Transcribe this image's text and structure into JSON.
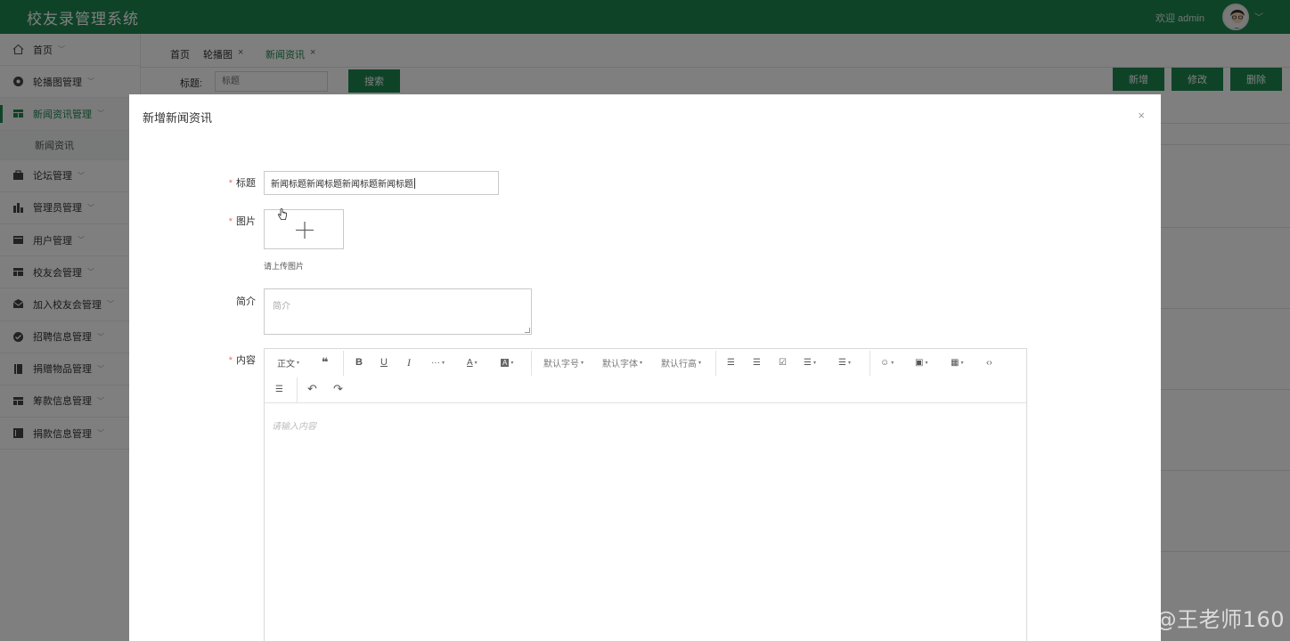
{
  "header": {
    "app_title": "校友录管理系统",
    "welcome": "欢迎 admin",
    "avatar_icon": "user-avatar-icon",
    "chevron": "﹀"
  },
  "sidebar": {
    "items": [
      {
        "label": "首页",
        "icon": "home-icon"
      },
      {
        "label": "轮播图管理",
        "icon": "carousel-icon"
      },
      {
        "label": "新闻资讯管理",
        "icon": "news-icon",
        "active": true
      },
      {
        "label": "论坛管理",
        "icon": "forum-icon"
      },
      {
        "label": "管理员管理",
        "icon": "admin-icon"
      },
      {
        "label": "用户管理",
        "icon": "user-icon"
      },
      {
        "label": "校友会管理",
        "icon": "alumni-icon"
      },
      {
        "label": "加入校友会管理",
        "icon": "mail-icon"
      },
      {
        "label": "招聘信息管理",
        "icon": "recruit-icon"
      },
      {
        "label": "捐赠物品管理",
        "icon": "donation-icon"
      },
      {
        "label": "筹款信息管理",
        "icon": "fundraise-icon"
      },
      {
        "label": "捐款信息管理",
        "icon": "donate-money-icon"
      }
    ],
    "sub_item": "新闻资讯"
  },
  "tabs": [
    {
      "label": "首页",
      "closable": false
    },
    {
      "label": "轮播图",
      "closable": true
    },
    {
      "label": "新闻资讯",
      "closable": true,
      "active": true
    }
  ],
  "tab_close": "×",
  "search": {
    "label": "标题:",
    "placeholder": "标题",
    "button": "搜索"
  },
  "actions": {
    "add": "新增",
    "edit": "修改",
    "delete": "删除"
  },
  "modal": {
    "title": "新增新闻资讯",
    "close": "×",
    "fields": {
      "title_label": "标题",
      "title_value": "新闻标题新闻标题新闻标题新闻标题",
      "image_label": "图片",
      "image_hint": "请上传图片",
      "intro_label": "简介",
      "intro_placeholder": "简介",
      "content_label": "内容",
      "required_mark": "*"
    },
    "editor": {
      "paragraph": "正文",
      "quote": "❝",
      "bold": "B",
      "underline": "U",
      "italic": "I",
      "more": "···",
      "font_color": "A",
      "bg_color": "A",
      "font_size": "默认字号",
      "font_family": "默认字体",
      "line_height": "默认行高",
      "ul": "☰",
      "ol": "☰",
      "todo": "☑",
      "align": "☰",
      "indent": "☰",
      "emoji": "☺",
      "image": "▣",
      "table": "▦",
      "code": "‹›",
      "divider": "☰",
      "undo": "↶",
      "redo": "↷",
      "placeholder": "请输入内容",
      "dropdown_mark": "▾"
    }
  },
  "watermark": "CSDN @王老师160",
  "colors": {
    "brand": "#1f8650",
    "danger": "#f56c6c"
  }
}
